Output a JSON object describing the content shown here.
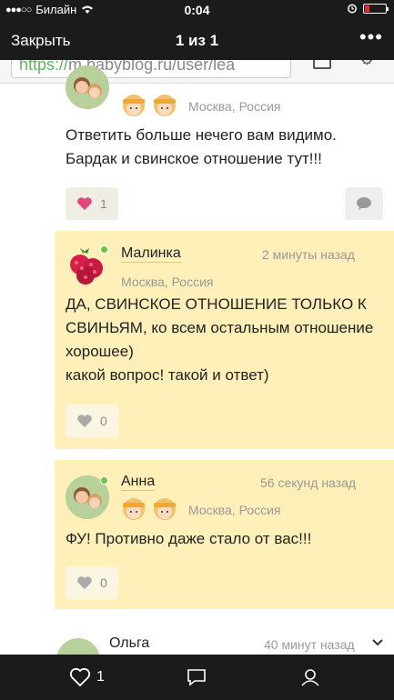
{
  "status_bar": {
    "carrier": "Билайн",
    "time": "0:04"
  },
  "nav": {
    "close_label": "Закрыть",
    "title": "1 из 1",
    "more_label": "•••"
  },
  "url_bar": {
    "protocol": "https://",
    "rest": "m.babyblog.ru/user/lea"
  },
  "comments": [
    {
      "location": "Москва, Россия",
      "text": "Ответить больше нечего вам видимо. Бардак и свинское отношение тут!!!",
      "likes": "1"
    },
    {
      "username": "Малинка",
      "time": "2 минуты назад",
      "location": "Москва, Россия",
      "text_lines": [
        "ДА, СВИНСКОЕ ОТНОШЕНИЕ ТОЛЬКО К СВИНЬЯМ, ко всем остальным отношение хорошее)",
        "какой вопрос! такой и ответ)"
      ],
      "likes": "0"
    },
    {
      "username": "Анна",
      "time": "56 секунд назад",
      "location": "Москва, Россия",
      "text": "ФУ! Противно даже стало от вас!!!",
      "likes": "0"
    },
    {
      "username": "Ольга",
      "time": "40 минут назад"
    }
  ],
  "toolbar": {
    "likes": "1"
  },
  "colors": {
    "highlight": "#fff0b9",
    "online": "#6ec34b",
    "like_heart": "#e0457b",
    "bars": "#1b1b1b"
  }
}
